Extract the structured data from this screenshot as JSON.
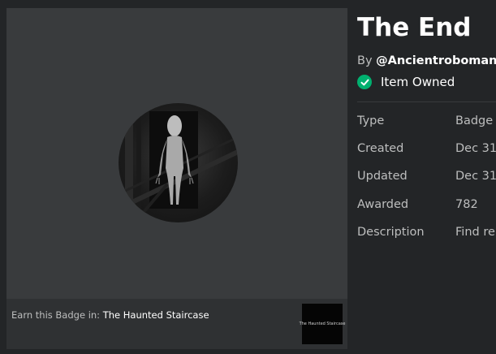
{
  "badge": {
    "title": "The End",
    "by_prefix": "By ",
    "creator": "@Ancientroboman",
    "owned_label": "Item Owned",
    "image_icon": "faceless-figure-badge-image"
  },
  "earn": {
    "prefix": "Earn this Badge in: ",
    "game_name": "The Haunted Staircase",
    "game_thumb_text": "The Haunted Staircase"
  },
  "details": [
    {
      "label": "Type",
      "value": "Badge"
    },
    {
      "label": "Created",
      "value": "Dec 31,"
    },
    {
      "label": "Updated",
      "value": "Dec 31,"
    },
    {
      "label": "Awarded",
      "value": "782"
    },
    {
      "label": "Description",
      "value": "Find re"
    }
  ],
  "colors": {
    "background": "#232527",
    "card": "#393b3d",
    "owned_check": "#00b06f"
  }
}
